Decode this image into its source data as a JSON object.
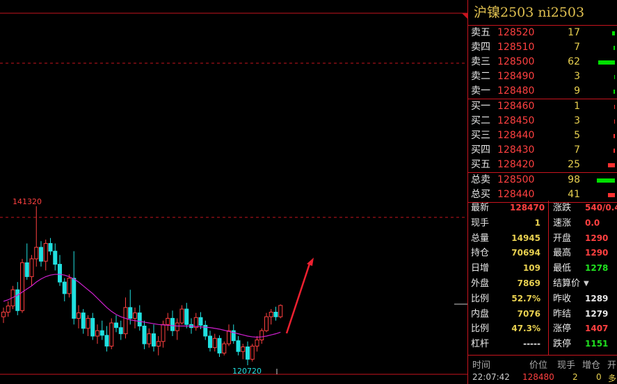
{
  "title": "沪镍2503 ni2503",
  "colors": {
    "up": "#ff4040",
    "down": "#20e0e0",
    "ma": "#d020d0",
    "grid": "#c8141e",
    "sell_bar": "#00e000",
    "buy_bar": "#ff3030"
  },
  "orderbook": {
    "asks": [
      {
        "label": "卖五",
        "price": "128520",
        "vol": "17",
        "bar": 4
      },
      {
        "label": "卖四",
        "price": "128510",
        "vol": "7",
        "bar": 2
      },
      {
        "label": "卖三",
        "price": "128500",
        "vol": "62",
        "bar": 24
      },
      {
        "label": "卖二",
        "price": "128490",
        "vol": "3",
        "bar": 1
      },
      {
        "label": "卖一",
        "price": "128480",
        "vol": "9",
        "bar": 2
      }
    ],
    "bids": [
      {
        "label": "买一",
        "price": "128460",
        "vol": "1",
        "bar": 1
      },
      {
        "label": "买二",
        "price": "128450",
        "vol": "3",
        "bar": 1
      },
      {
        "label": "买三",
        "price": "128440",
        "vol": "5",
        "bar": 2
      },
      {
        "label": "买四",
        "price": "128430",
        "vol": "7",
        "bar": 2
      },
      {
        "label": "买五",
        "price": "128420",
        "vol": "25",
        "bar": 10
      }
    ],
    "totals": [
      {
        "label": "总卖",
        "price": "128500",
        "vol": "98",
        "bar": 26,
        "color": "#00e000"
      },
      {
        "label": "总买",
        "price": "128440",
        "vol": "41",
        "bar": 10,
        "color": "#ff3030"
      }
    ]
  },
  "stats": [
    {
      "l1": "最新",
      "v1": "128470",
      "c1": "#ff4040",
      "l2": "涨跌",
      "v2": "540/0.4",
      "c2": "#ff4040"
    },
    {
      "l1": "现手",
      "v1": "1",
      "c1": "#e8d050",
      "l2": "速涨",
      "v2": "0.0",
      "c2": "#ff4040"
    },
    {
      "l1": "总量",
      "v1": "14945",
      "c1": "#e8d050",
      "l2": "开盘",
      "v2": "1290",
      "c2": "#ff4040"
    },
    {
      "l1": "持仓",
      "v1": "70694",
      "c1": "#e8d050",
      "l2": "最高",
      "v2": "1290",
      "c2": "#ff4040"
    },
    {
      "l1": "日增",
      "v1": "109",
      "c1": "#e8d050",
      "l2": "最低",
      "v2": "1278",
      "c2": "#20e020"
    },
    {
      "l1": "外盘",
      "v1": "7869",
      "c1": "#e8d050",
      "l2": "结算价",
      "v2": "",
      "c2": "#e8e8e8"
    },
    {
      "l1": "比例",
      "v1": "52.7%",
      "c1": "#e8d050",
      "l2": "昨收",
      "v2": "1289",
      "c2": "#e8e8e8"
    },
    {
      "l1": "内盘",
      "v1": "7076",
      "c1": "#e8d050",
      "l2": "昨结",
      "v2": "1279",
      "c2": "#e8e8e8"
    },
    {
      "l1": "比例",
      "v1": "47.3%",
      "c1": "#e8d050",
      "l2": "涨停",
      "v2": "1407",
      "c2": "#ff4040"
    },
    {
      "l1": "杠杆",
      "v1": "-----",
      "c1": "#e8e8e8",
      "l2": "跌停",
      "v2": "1151",
      "c2": "#20e020"
    }
  ],
  "trade_header": [
    "时间",
    "价位",
    "现手",
    "增仓",
    "开"
  ],
  "last_trade": {
    "time": "22:07:42",
    "price": "128480",
    "vol": "2",
    "oi": "0",
    "type": "多"
  },
  "chart_data": {
    "type": "candlestick",
    "high_label": "141320",
    "low_label": "120720",
    "candles": [
      {
        "o": 127000,
        "h": 128200,
        "l": 126200,
        "c": 127600
      },
      {
        "o": 127600,
        "h": 129000,
        "l": 127000,
        "c": 128400
      },
      {
        "o": 128400,
        "h": 131000,
        "l": 128000,
        "c": 130500
      },
      {
        "o": 130500,
        "h": 131500,
        "l": 127200,
        "c": 127800
      },
      {
        "o": 127800,
        "h": 134500,
        "l": 127500,
        "c": 134000
      },
      {
        "o": 134000,
        "h": 136500,
        "l": 131800,
        "c": 132200
      },
      {
        "o": 132200,
        "h": 135000,
        "l": 131000,
        "c": 134500
      },
      {
        "o": 134500,
        "h": 141320,
        "l": 133500,
        "c": 136000
      },
      {
        "o": 136000,
        "h": 136800,
        "l": 133500,
        "c": 134200
      },
      {
        "o": 134200,
        "h": 137000,
        "l": 133000,
        "c": 136500
      },
      {
        "o": 136500,
        "h": 137200,
        "l": 135000,
        "c": 135500
      },
      {
        "o": 135500,
        "h": 136500,
        "l": 133000,
        "c": 133800
      },
      {
        "o": 133800,
        "h": 135000,
        "l": 131000,
        "c": 131500
      },
      {
        "o": 131500,
        "h": 132000,
        "l": 129000,
        "c": 130000
      },
      {
        "o": 130000,
        "h": 132500,
        "l": 129500,
        "c": 132000
      },
      {
        "o": 132000,
        "h": 135500,
        "l": 126000,
        "c": 126800
      },
      {
        "o": 126800,
        "h": 128500,
        "l": 125500,
        "c": 127500
      },
      {
        "o": 127500,
        "h": 128000,
        "l": 124800,
        "c": 125500
      },
      {
        "o": 125500,
        "h": 127200,
        "l": 124500,
        "c": 126800
      },
      {
        "o": 126800,
        "h": 127500,
        "l": 124000,
        "c": 124500
      },
      {
        "o": 124500,
        "h": 126000,
        "l": 123500,
        "c": 125200
      },
      {
        "o": 125200,
        "h": 126500,
        "l": 124000,
        "c": 124600
      },
      {
        "o": 124600,
        "h": 125800,
        "l": 122500,
        "c": 123200
      },
      {
        "o": 123200,
        "h": 126800,
        "l": 122800,
        "c": 126200
      },
      {
        "o": 126200,
        "h": 127200,
        "l": 125000,
        "c": 125600
      },
      {
        "o": 125600,
        "h": 126500,
        "l": 124000,
        "c": 124800
      },
      {
        "o": 124800,
        "h": 129500,
        "l": 124200,
        "c": 128200
      },
      {
        "o": 128200,
        "h": 130500,
        "l": 126000,
        "c": 126800
      },
      {
        "o": 126800,
        "h": 128200,
        "l": 125500,
        "c": 127500
      },
      {
        "o": 127500,
        "h": 128500,
        "l": 125200,
        "c": 125800
      },
      {
        "o": 125800,
        "h": 126500,
        "l": 122800,
        "c": 123500
      },
      {
        "o": 123500,
        "h": 125500,
        "l": 123000,
        "c": 124800
      },
      {
        "o": 124800,
        "h": 126000,
        "l": 122500,
        "c": 123200
      },
      {
        "o": 123200,
        "h": 124500,
        "l": 122000,
        "c": 123800
      },
      {
        "o": 123800,
        "h": 126500,
        "l": 123000,
        "c": 126000
      },
      {
        "o": 126000,
        "h": 127500,
        "l": 125200,
        "c": 126800
      },
      {
        "o": 126800,
        "h": 127800,
        "l": 124500,
        "c": 125200
      },
      {
        "o": 125200,
        "h": 126800,
        "l": 124000,
        "c": 126200
      },
      {
        "o": 126200,
        "h": 128500,
        "l": 126000,
        "c": 128000
      },
      {
        "o": 128000,
        "h": 128800,
        "l": 125500,
        "c": 126000
      },
      {
        "o": 126000,
        "h": 126800,
        "l": 124800,
        "c": 125600
      },
      {
        "o": 125600,
        "h": 127500,
        "l": 125200,
        "c": 126900
      },
      {
        "o": 126900,
        "h": 127600,
        "l": 125400,
        "c": 125900
      },
      {
        "o": 125900,
        "h": 126500,
        "l": 124000,
        "c": 124500
      },
      {
        "o": 124500,
        "h": 125200,
        "l": 122500,
        "c": 123000
      },
      {
        "o": 123000,
        "h": 124800,
        "l": 122500,
        "c": 124200
      },
      {
        "o": 124200,
        "h": 124600,
        "l": 121800,
        "c": 122300
      },
      {
        "o": 122300,
        "h": 123800,
        "l": 122000,
        "c": 123500
      },
      {
        "o": 123500,
        "h": 126000,
        "l": 123200,
        "c": 125200
      },
      {
        "o": 125200,
        "h": 126000,
        "l": 123500,
        "c": 123900
      },
      {
        "o": 123900,
        "h": 124500,
        "l": 122000,
        "c": 122500
      },
      {
        "o": 122500,
        "h": 123500,
        "l": 121500,
        "c": 123100
      },
      {
        "o": 123100,
        "h": 123800,
        "l": 120720,
        "c": 121500
      },
      {
        "o": 121500,
        "h": 123500,
        "l": 121200,
        "c": 123200
      },
      {
        "o": 123200,
        "h": 124500,
        "l": 122500,
        "c": 124000
      },
      {
        "o": 124000,
        "h": 125500,
        "l": 123500,
        "c": 125200
      },
      {
        "o": 125200,
        "h": 127500,
        "l": 125000,
        "c": 127000
      },
      {
        "o": 127000,
        "h": 128000,
        "l": 126000,
        "c": 127600
      },
      {
        "o": 127600,
        "h": 128300,
        "l": 126500,
        "c": 127000
      },
      {
        "o": 127000,
        "h": 128600,
        "l": 126800,
        "c": 128470
      }
    ],
    "ma": [
      129000,
      129200,
      129500,
      129800,
      130200,
      130600,
      131000,
      131500,
      131900,
      132200,
      132400,
      132500,
      132500,
      132400,
      132200,
      131900,
      131500,
      131000,
      130500,
      130000,
      129400,
      128800,
      128200,
      127700,
      127300,
      127000,
      126800,
      126600,
      126500,
      126400,
      126300,
      126200,
      126100,
      126000,
      125950,
      125900,
      125850,
      125800,
      125800,
      125800,
      125800,
      125750,
      125700,
      125650,
      125600,
      125500,
      125400,
      125250,
      125100,
      124950,
      124800,
      124650,
      124500,
      124400,
      124350,
      124400,
      124500,
      124650,
      124800,
      125000
    ]
  }
}
